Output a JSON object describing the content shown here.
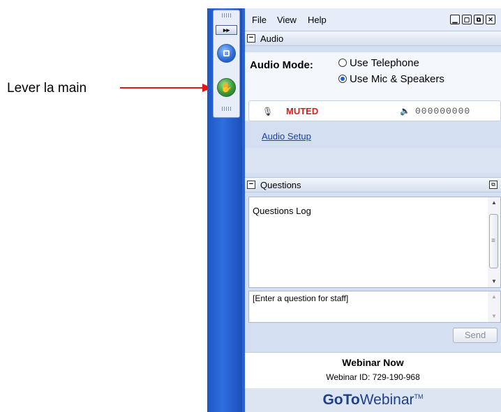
{
  "annotation": {
    "label": "Lever la main"
  },
  "dock": {
    "collapse_glyph": "▸▸",
    "buttons": [
      "show-panel-icon",
      "raise-hand-icon"
    ]
  },
  "menubar": {
    "file": "File",
    "view": "View",
    "help": "Help",
    "window_buttons": [
      "minimize-icon",
      "maximize-icon",
      "restore-icon",
      "close-icon"
    ]
  },
  "audio": {
    "section_title": "Audio",
    "mode_label": "Audio Mode:",
    "option_telephone": "Use Telephone",
    "option_mic": "Use Mic & Speakers",
    "selected": "Use Mic & Speakers",
    "status": "MUTED",
    "pin_code": "000000000",
    "setup_link": "Audio Setup",
    "status_color": "#d42020"
  },
  "questions": {
    "section_title": "Questions",
    "log_text": "Questions Log",
    "input_placeholder": "[Enter a question for staff]",
    "send_label": "Send"
  },
  "footer": {
    "title": "Webinar Now",
    "webinar_id": "Webinar ID: 729-190-968",
    "brand_bold": "GoTo",
    "brand_light": "Webinar",
    "brand_tm": "TM"
  },
  "colors": {
    "accent": "#2e6ee0",
    "link": "#1a3fb0",
    "annotation_arrow": "#e01818"
  }
}
